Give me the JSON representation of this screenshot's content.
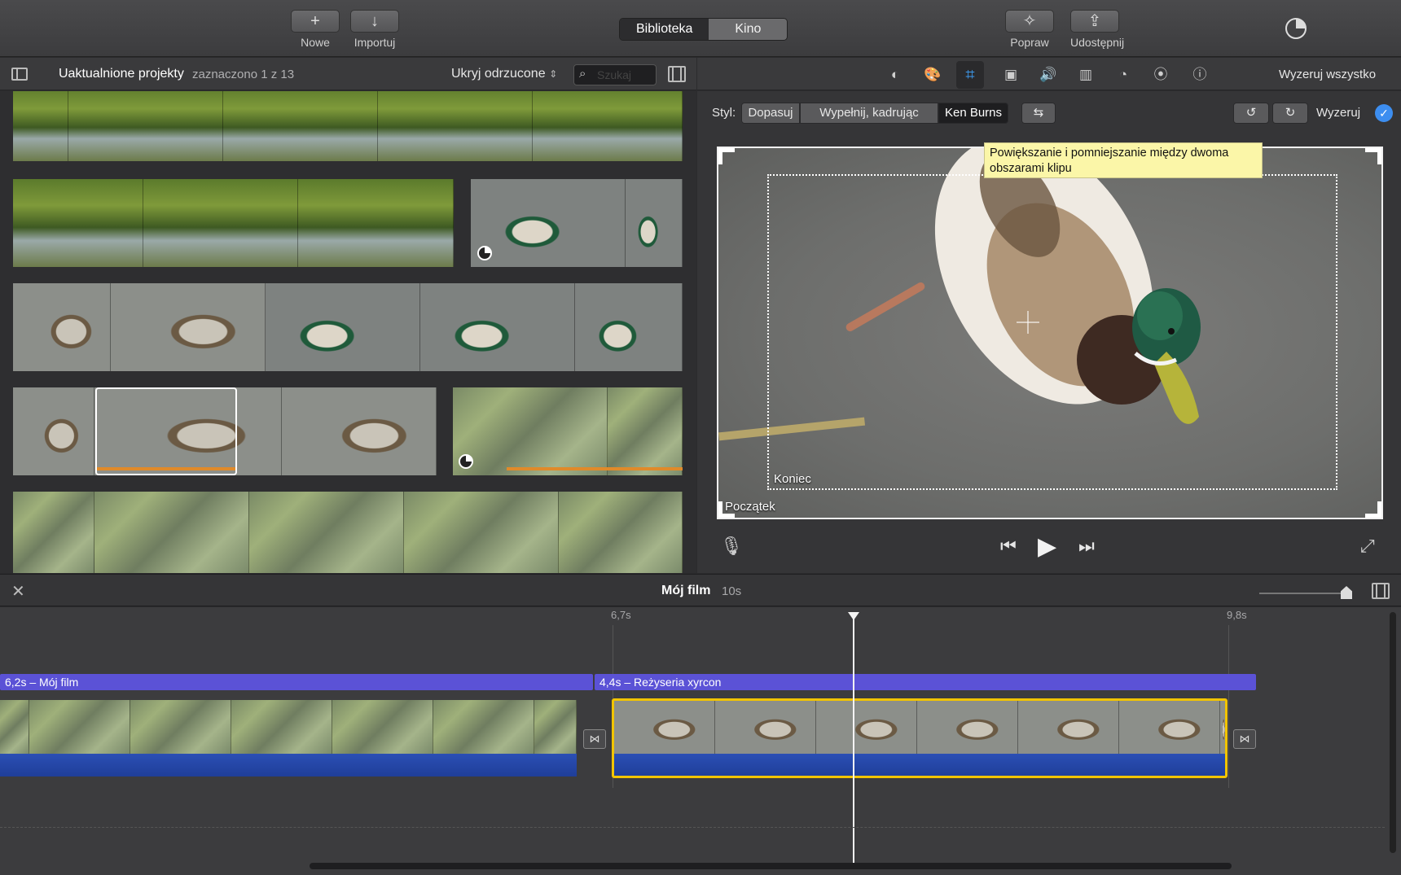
{
  "toolbar": {
    "new_label": "Nowe",
    "import_label": "Importuj",
    "tab_library": "Biblioteka",
    "tab_theater": "Kino",
    "enhance_label": "Popraw",
    "share_label": "Udostępnij"
  },
  "browser": {
    "project_title": "Uaktualnione projekty",
    "selection_info": "zaznaczono 1 z 13",
    "filter_label": "Ukryj odrzucone",
    "search_placeholder": "Szukaj"
  },
  "viewer_tools": {
    "reset_all_label": "Wyzeruj wszystko",
    "icons": [
      "color-balance-icon",
      "color-correction-icon",
      "crop-icon",
      "stabilization-icon",
      "volume-icon",
      "noise-reduction-icon",
      "speed-icon",
      "clip-filter-icon",
      "info-icon"
    ]
  },
  "crop": {
    "style_label": "Styl:",
    "fit_label": "Dopasuj",
    "fill_crop_label": "Wypełnij, kadrując",
    "ken_burns_label": "Ken Burns",
    "reset_label": "Wyzeruj",
    "tooltip": "Powiększanie i pomniejszanie między dwoma obszarami klipu",
    "end_label": "Koniec",
    "start_label": "Początek"
  },
  "timeline": {
    "movie_title": "Mój film",
    "movie_duration": "10s",
    "ruler_left": "6,7s",
    "ruler_right": "9,8s",
    "title_clip_1": "6,2s – Mój film",
    "title_clip_2": "4,4s –  Reżyseria xyrcon"
  },
  "colors": {
    "title_bar": "#5b52d6",
    "audio": "#2b4fb5",
    "selection": "#f2c400",
    "accent_blue": "#3d8ef0"
  }
}
